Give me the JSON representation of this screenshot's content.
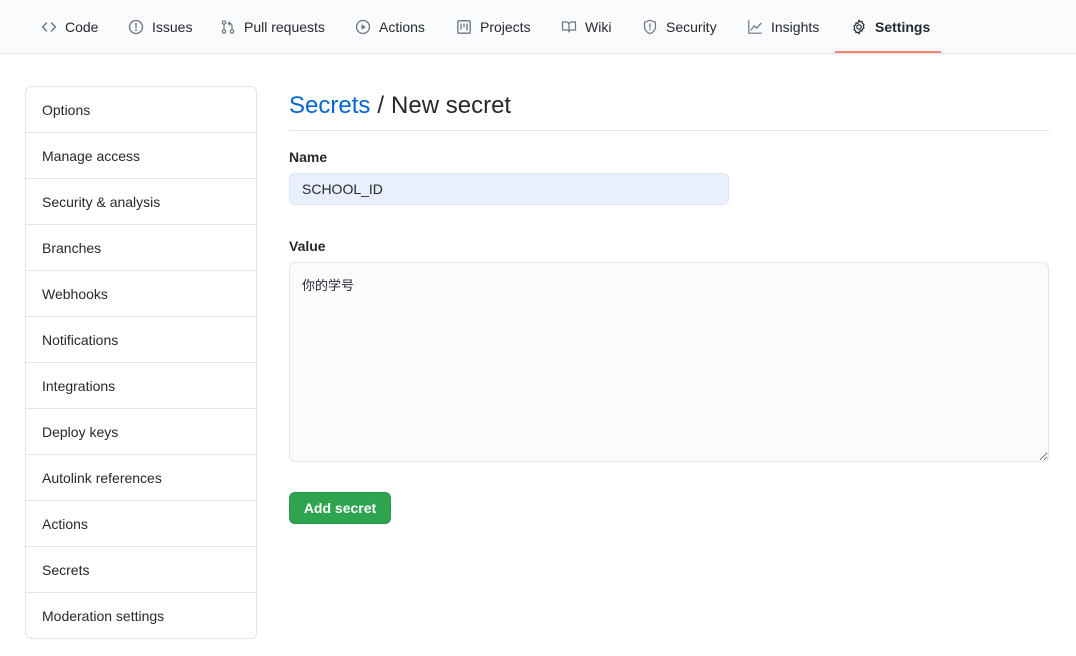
{
  "tabs": [
    {
      "id": "code",
      "label": "Code",
      "icon": "code-icon"
    },
    {
      "id": "issues",
      "label": "Issues",
      "icon": "issue-opened-icon"
    },
    {
      "id": "pulls",
      "label": "Pull requests",
      "icon": "git-pull-request-icon"
    },
    {
      "id": "actions",
      "label": "Actions",
      "icon": "play-icon"
    },
    {
      "id": "projects",
      "label": "Projects",
      "icon": "project-icon"
    },
    {
      "id": "wiki",
      "label": "Wiki",
      "icon": "book-icon"
    },
    {
      "id": "security",
      "label": "Security",
      "icon": "shield-icon"
    },
    {
      "id": "insights",
      "label": "Insights",
      "icon": "graph-icon"
    },
    {
      "id": "settings",
      "label": "Settings",
      "icon": "gear-icon",
      "selected": true
    }
  ],
  "sidebar": {
    "items": [
      {
        "label": "Options"
      },
      {
        "label": "Manage access"
      },
      {
        "label": "Security & analysis"
      },
      {
        "label": "Branches"
      },
      {
        "label": "Webhooks"
      },
      {
        "label": "Notifications"
      },
      {
        "label": "Integrations"
      },
      {
        "label": "Deploy keys"
      },
      {
        "label": "Autolink references"
      },
      {
        "label": "Actions"
      },
      {
        "label": "Secrets"
      },
      {
        "label": "Moderation settings"
      }
    ]
  },
  "main": {
    "breadcrumb_link": "Secrets",
    "breadcrumb_separator": "/",
    "page_title": "New secret",
    "name_label": "Name",
    "name_value": "SCHOOL_ID",
    "value_label": "Value",
    "value_text": "你的学号",
    "submit_label": "Add secret"
  },
  "colors": {
    "accent_link": "#0366d6",
    "selected_tab_underline": "#f9826c",
    "primary_button": "#2ea44f",
    "autofill_background": "#e8f0fe"
  }
}
